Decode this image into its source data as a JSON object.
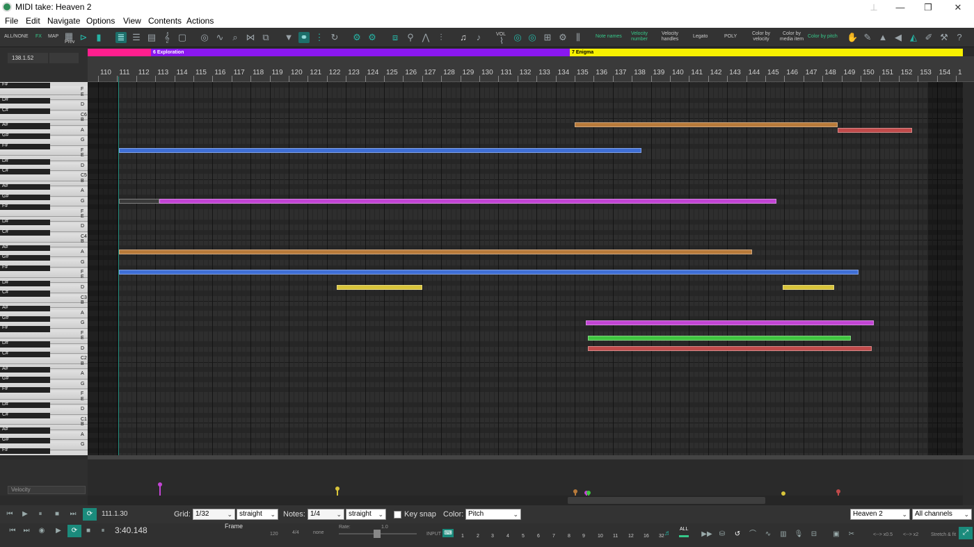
{
  "window": {
    "title": "MIDI take: Heaven 2",
    "minimize": "—",
    "maximize": "❐",
    "close": "✕"
  },
  "menu": [
    "File",
    "Edit",
    "Navigate",
    "Options",
    "View",
    "Contents",
    "Actions"
  ],
  "toolbar": {
    "allnone": "ALL/NONE",
    "fx": "FX",
    "map": "MAP",
    "prev": "Prev",
    "vol": "VOL",
    "note_names": "Note names",
    "velocity_number": "Velocity number",
    "velocity_handles": "Velocity handles",
    "legato": "Legato",
    "poly": "POLY",
    "color_by_velocity": "Color by velocity",
    "color_by_media_item": "Color by media item",
    "color_by_pitch": "Color by pitch"
  },
  "position": "138.1.52",
  "regions": [
    {
      "label": "",
      "color": "#ff1f8e"
    },
    {
      "label": "6  Exploration",
      "color": "#8a17f0"
    },
    {
      "label": "7  Enigma",
      "color": "#f7f000"
    }
  ],
  "measures": [
    "110",
    "111",
    "112",
    "113",
    "114",
    "115",
    "116",
    "117",
    "118",
    "119",
    "120",
    "121",
    "122",
    "123",
    "124",
    "125",
    "126",
    "127",
    "128",
    "129",
    "130",
    "131",
    "132",
    "133",
    "134",
    "135",
    "136",
    "137",
    "138",
    "139",
    "140",
    "141",
    "142",
    "143",
    "144",
    "145",
    "146",
    "147",
    "148",
    "149",
    "150",
    "151",
    "152",
    "153",
    "154",
    "1"
  ],
  "keys": [
    {
      "label": "F#",
      "black": true
    },
    {
      "label": "F"
    },
    {
      "label": "E"
    },
    {
      "label": "D#",
      "black": true
    },
    {
      "label": "D"
    },
    {
      "label": "C#",
      "black": true
    },
    {
      "label": "C6"
    },
    {
      "label": "B"
    },
    {
      "label": "A#",
      "black": true
    },
    {
      "label": "A"
    },
    {
      "label": "G#",
      "black": true
    },
    {
      "label": "G"
    },
    {
      "label": "F#",
      "black": true
    },
    {
      "label": "F"
    },
    {
      "label": "E"
    },
    {
      "label": "D#",
      "black": true
    },
    {
      "label": "D"
    },
    {
      "label": "C#",
      "black": true
    },
    {
      "label": "C5"
    },
    {
      "label": "B"
    },
    {
      "label": "A#",
      "black": true
    },
    {
      "label": "A"
    },
    {
      "label": "G#",
      "black": true
    },
    {
      "label": "G"
    },
    {
      "label": "F#",
      "black": true
    },
    {
      "label": "F"
    },
    {
      "label": "E"
    },
    {
      "label": "D#",
      "black": true
    },
    {
      "label": "D"
    },
    {
      "label": "C#",
      "black": true
    },
    {
      "label": "C4"
    },
    {
      "label": "B"
    },
    {
      "label": "A#",
      "black": true
    },
    {
      "label": "A"
    },
    {
      "label": "G#",
      "black": true
    },
    {
      "label": "G"
    },
    {
      "label": "F#",
      "black": true
    },
    {
      "label": "F"
    },
    {
      "label": "E"
    },
    {
      "label": "D#",
      "black": true
    },
    {
      "label": "D"
    },
    {
      "label": "C#",
      "black": true
    },
    {
      "label": "C3"
    },
    {
      "label": "B"
    },
    {
      "label": "A#",
      "black": true
    },
    {
      "label": "A"
    },
    {
      "label": "G#",
      "black": true
    },
    {
      "label": "G"
    },
    {
      "label": "F#",
      "black": true
    },
    {
      "label": "F"
    },
    {
      "label": "E"
    },
    {
      "label": "D#",
      "black": true
    },
    {
      "label": "D"
    },
    {
      "label": "C#",
      "black": true
    },
    {
      "label": "C2"
    },
    {
      "label": "B"
    },
    {
      "label": "A#",
      "black": true
    },
    {
      "label": "A"
    },
    {
      "label": "G#",
      "black": true
    },
    {
      "label": "G"
    },
    {
      "label": "F#",
      "black": true
    },
    {
      "label": "F"
    },
    {
      "label": "E"
    },
    {
      "label": "D#",
      "black": true
    },
    {
      "label": "D"
    },
    {
      "label": "C#",
      "black": true
    },
    {
      "label": "C1"
    },
    {
      "label": "B"
    },
    {
      "label": "A#",
      "black": true
    },
    {
      "label": "A"
    },
    {
      "label": "G#",
      "black": true
    },
    {
      "label": "G"
    },
    {
      "label": "F#",
      "black": true
    }
  ],
  "notes": [
    {
      "pitch": "A#5",
      "start": 135.0,
      "end": 148.8,
      "color": "#b87a3a"
    },
    {
      "pitch": "A5",
      "start": 148.8,
      "end": 152.7,
      "color": "#c04a4a"
    },
    {
      "pitch": "F5",
      "start": 111.1,
      "end": 138.5,
      "color": "#3f6fd6"
    },
    {
      "pitch": "G4",
      "start": 111.1,
      "end": 113.2,
      "color": "#3a3a3a"
    },
    {
      "pitch": "G4",
      "start": 113.2,
      "end": 145.6,
      "color": "#c244d4"
    },
    {
      "pitch": "A3",
      "start": 111.1,
      "end": 144.3,
      "color": "#b87a3a"
    },
    {
      "pitch": "F3",
      "start": 111.1,
      "end": 149.9,
      "color": "#3f6fd6"
    },
    {
      "pitch": "D3",
      "start": 122.5,
      "end": 127.0,
      "color": "#d8c43a"
    },
    {
      "pitch": "D3",
      "start": 145.9,
      "end": 148.6,
      "color": "#d8c43a"
    },
    {
      "pitch": "G2",
      "start": 135.6,
      "end": 150.7,
      "color": "#c244d4"
    },
    {
      "pitch": "E2",
      "start": 135.7,
      "end": 149.5,
      "color": "#3fc43f"
    },
    {
      "pitch": "D2",
      "start": 135.7,
      "end": 150.6,
      "color": "#c04a4a"
    }
  ],
  "velocity_lane": {
    "label": "Velocity",
    "points": [
      {
        "measure": 113.2,
        "value": 0.31,
        "color": "#c244d4"
      },
      {
        "measure": 122.5,
        "value": 0.2,
        "color": "#d8c43a"
      },
      {
        "measure": 135.0,
        "value": 0.12,
        "color": "#b87a3a"
      },
      {
        "measure": 135.6,
        "value": 0.08,
        "color": "#c244d4"
      },
      {
        "measure": 135.7,
        "value": 0.08,
        "color": "#3fc43f"
      },
      {
        "measure": 145.9,
        "value": 0.06,
        "color": "#d8c43a"
      },
      {
        "measure": 148.8,
        "value": 0.12,
        "color": "#c04a4a"
      }
    ]
  },
  "transport": {
    "position": "111.1.30",
    "time": "3:40.148",
    "grid_label": "Grid:",
    "grid_value": "1/32",
    "grid_type": "straight",
    "notes_label": "Notes:",
    "notes_value": "1/4",
    "notes_type": "straight",
    "key_snap": "Key snap",
    "color_label": "Color:",
    "color_value": "Pitch",
    "take": "Heaven 2",
    "channels": "All channels",
    "frame": "Frame",
    "tempo": "120",
    "timesig": "4/4",
    "swing": "none",
    "rate_label": "Rate:",
    "rate_value": "1.0",
    "input": "INPUT",
    "all": "ALL",
    "channel_numbers": [
      "1",
      "2",
      "3",
      "4",
      "5",
      "6",
      "7",
      "8",
      "9",
      "10",
      "11",
      "12",
      "16",
      "32"
    ],
    "zoom_half": "<--> x0.5",
    "zoom_double": "<--> x2",
    "stretch": "Stretch & fit"
  }
}
